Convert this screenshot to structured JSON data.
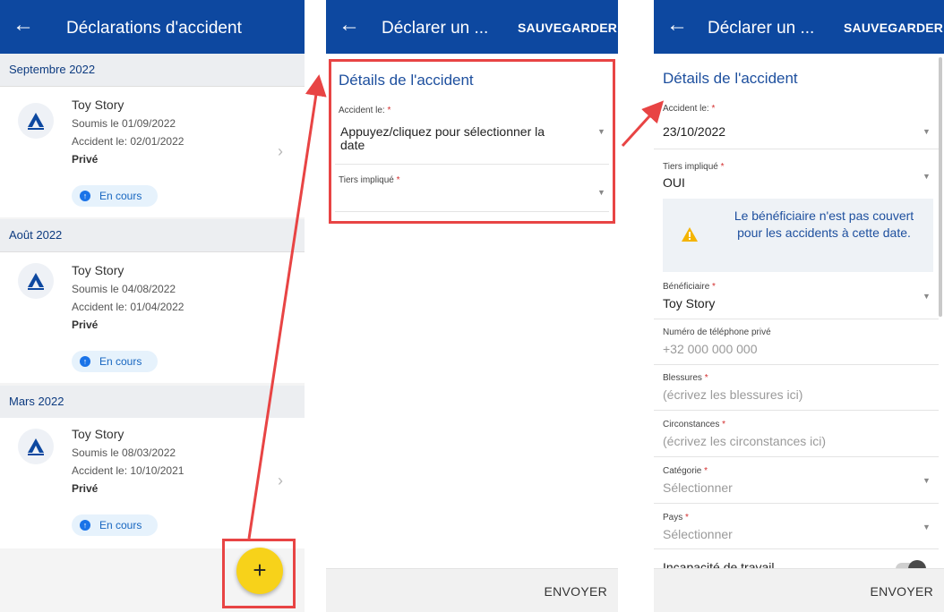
{
  "list_screen": {
    "title": "Déclarations d'accident",
    "back_icon": "arrow-left-icon",
    "groups": [
      {
        "month": "Septembre 2022",
        "item": {
          "name": "Toy Story",
          "submitted": "Soumis le 01/09/2022",
          "accident": "Accident le: 02/01/2022",
          "type": "Privé",
          "status": "En cours"
        }
      },
      {
        "month": "Août 2022",
        "item": {
          "name": "Toy Story",
          "submitted": "Soumis le 04/08/2022",
          "accident": "Accident le: 01/04/2022",
          "type": "Privé",
          "status": "En cours"
        }
      },
      {
        "month": "Mars 2022",
        "item": {
          "name": "Toy Story",
          "submitted": "Soumis le 08/03/2022",
          "accident": "Accident le: 10/10/2021",
          "type": "Privé",
          "status": "En cours"
        }
      }
    ],
    "fab_label": "+"
  },
  "form_empty": {
    "title": "Déclarer un ...",
    "save": "SAUVEGARDER",
    "section": "Détails de l'accident",
    "date_label": "Accident le:",
    "date_value": "Appuyez/cliquez pour sélectionner la date",
    "third_label": "Tiers impliqué",
    "send": "ENVOYER"
  },
  "form_filled": {
    "title": "Déclarer un ...",
    "save": "SAUVEGARDER",
    "section": "Détails de l'accident",
    "date_label": "Accident le:",
    "date_value": "23/10/2022",
    "third_label": "Tiers impliqué",
    "third_value": "OUI",
    "warning": "Le bénéficiaire n'est pas couvert pour les accidents à cette date.",
    "beneficiary_label": "Bénéficiaire",
    "beneficiary_value": "Toy Story",
    "phone_label": "Numéro de téléphone privé",
    "phone_placeholder": "+32 000 000 000",
    "injuries_label": "Blessures",
    "injuries_placeholder": "(écrivez les blessures ici)",
    "circ_label": "Circonstances",
    "circ_placeholder": "(écrivez les circonstances ici)",
    "category_label": "Catégorie",
    "category_placeholder": "Sélectionner",
    "country_label": "Pays",
    "country_placeholder": "Sélectionner",
    "incapacity_label": "Incapacité de travail",
    "send": "ENVOYER"
  },
  "required_mark": "*",
  "colors": {
    "appbar": "#0d48a0",
    "accent_yellow": "#f7d21a",
    "annotation_red": "#e84444"
  }
}
